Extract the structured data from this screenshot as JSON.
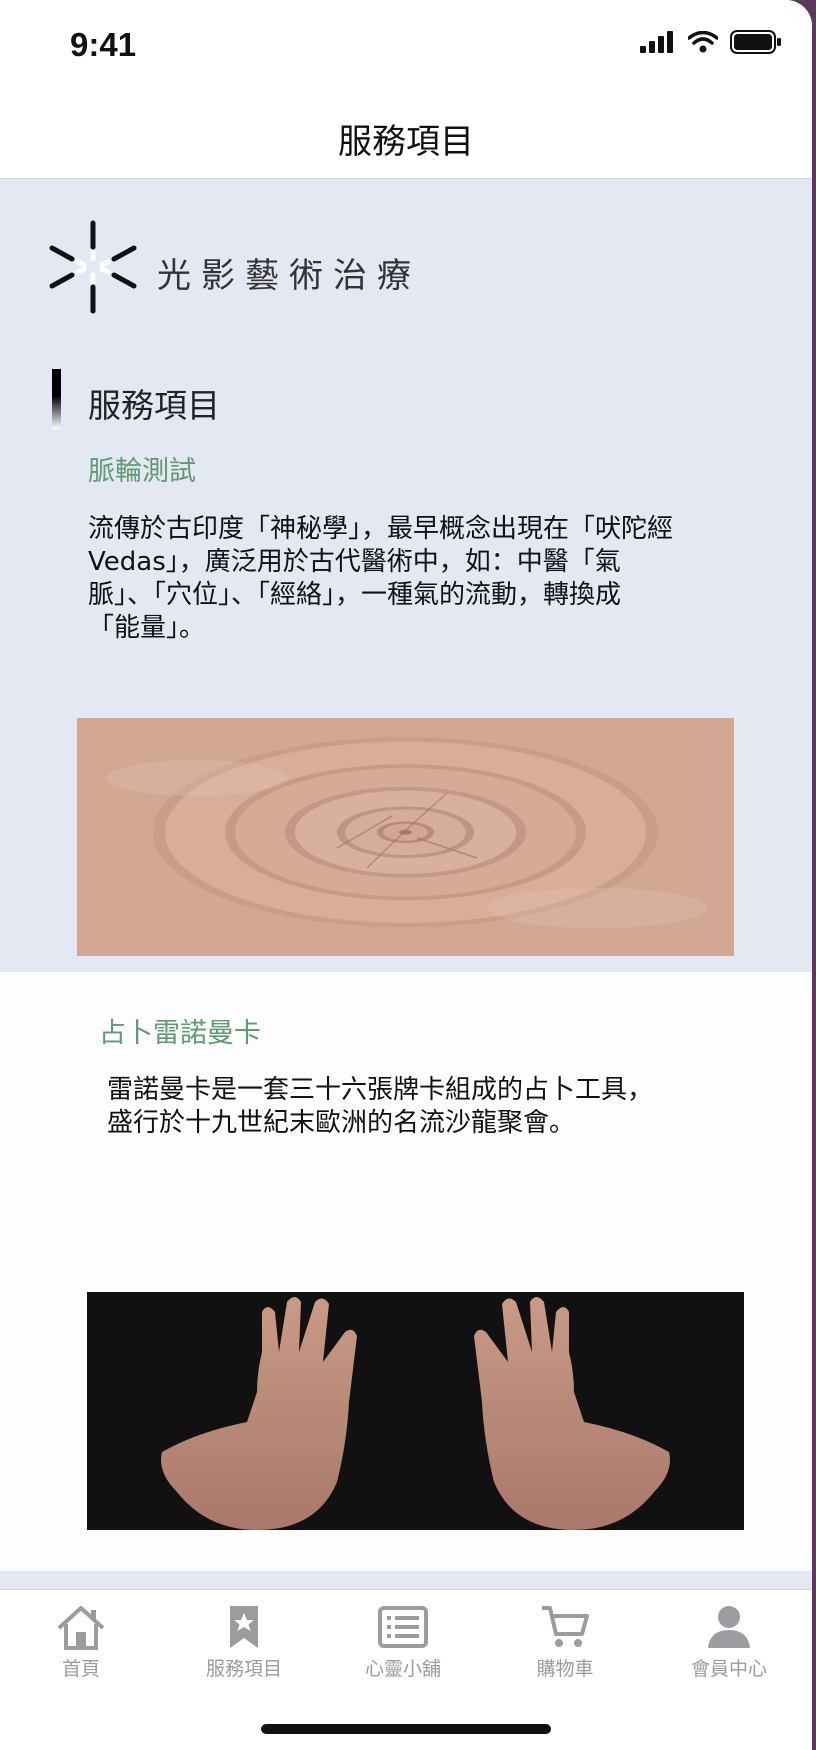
{
  "status_bar": {
    "time": "9:41"
  },
  "nav": {
    "title": "服務項目"
  },
  "brand": {
    "logo_text": "光影藝術治療"
  },
  "section": {
    "heading": "服務項目"
  },
  "services": [
    {
      "title": "脈輪測試",
      "description_lines": [
        "流傳於古印度「神秘學」，最早概念出現在「吠陀經",
        "Vedas」，廣泛用於古代醫術中，如：中醫「氣",
        "脈」、「穴位」、「經絡」，一種氣的流動，轉換成",
        "「能量」。"
      ],
      "image": "wood-texture"
    },
    {
      "title": "占卜雷諾曼卡",
      "description_lines": [
        "雷諾曼卡是一套三十六張牌卡組成的占卜工具，",
        "盛行於十九世紀末歐洲的名流沙龍聚會。"
      ],
      "image": "palms"
    }
  ],
  "tabs": [
    {
      "label": "首頁",
      "icon": "home-icon"
    },
    {
      "label": "服務項目",
      "icon": "bookmark-star-icon"
    },
    {
      "label": "心靈小舖",
      "icon": "list-icon"
    },
    {
      "label": "購物車",
      "icon": "cart-icon"
    },
    {
      "label": "會員中心",
      "icon": "person-icon"
    }
  ],
  "colors": {
    "accent_green": "#5e9a72",
    "section_bg": "#e4e8f2",
    "tab_inactive": "#9b9ba0"
  }
}
